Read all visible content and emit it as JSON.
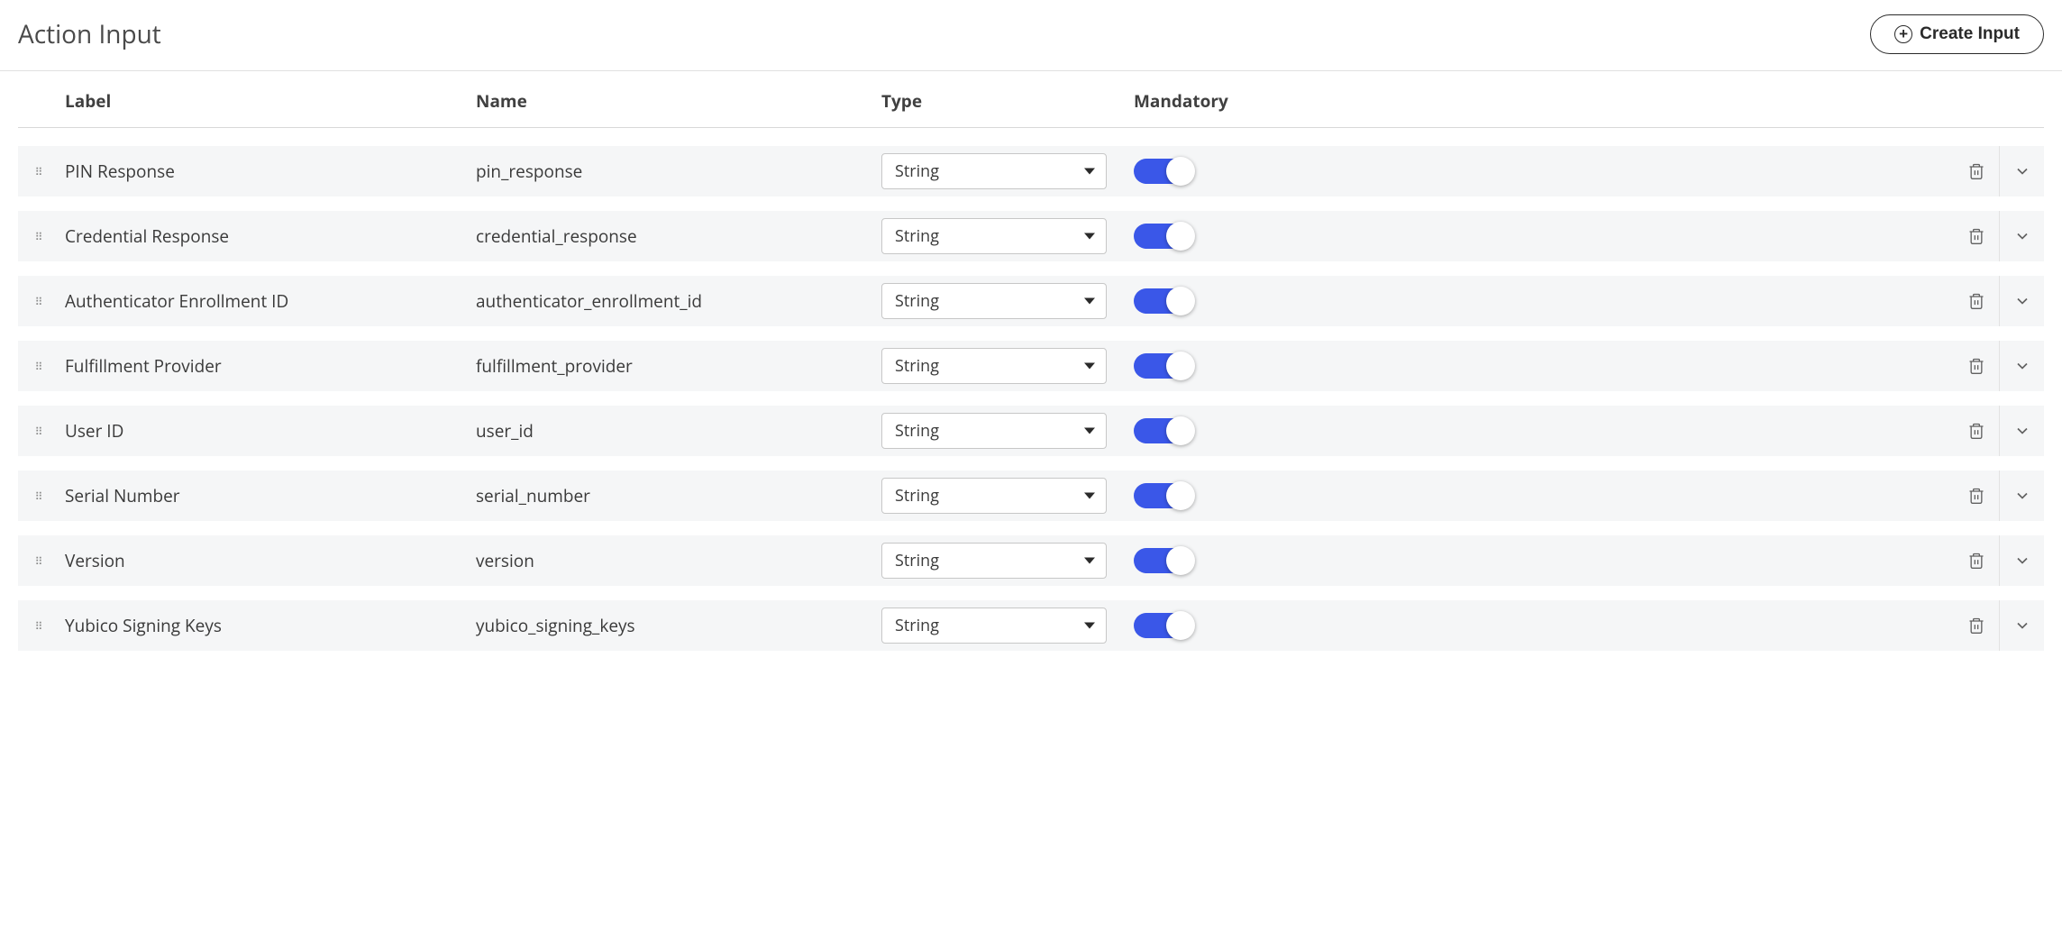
{
  "header": {
    "title": "Action Input",
    "create_button": "Create Input"
  },
  "columns": {
    "label": "Label",
    "name": "Name",
    "type": "Type",
    "mandatory": "Mandatory"
  },
  "rows": [
    {
      "label": "PIN Response",
      "name": "pin_response",
      "type": "String",
      "mandatory": true
    },
    {
      "label": "Credential Response",
      "name": "credential_response",
      "type": "String",
      "mandatory": true
    },
    {
      "label": "Authenticator Enrollment ID",
      "name": "authenticator_enrollment_id",
      "type": "String",
      "mandatory": true
    },
    {
      "label": "Fulfillment Provider",
      "name": "fulfillment_provider",
      "type": "String",
      "mandatory": true
    },
    {
      "label": "User ID",
      "name": "user_id",
      "type": "String",
      "mandatory": true
    },
    {
      "label": "Serial Number",
      "name": "serial_number",
      "type": "String",
      "mandatory": true
    },
    {
      "label": "Version",
      "name": "version",
      "type": "String",
      "mandatory": true
    },
    {
      "label": "Yubico Signing Keys",
      "name": "yubico_signing_keys",
      "type": "String",
      "mandatory": true
    }
  ]
}
